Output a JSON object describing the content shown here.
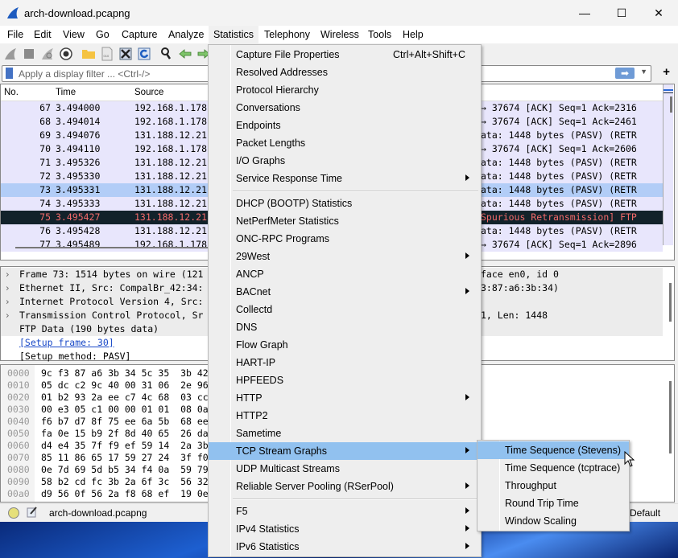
{
  "window": {
    "title": "arch-download.pcapng",
    "controls": {
      "minimize": "—",
      "maximize": "☐",
      "close": "✕"
    }
  },
  "menubar": [
    "File",
    "Edit",
    "View",
    "Go",
    "Capture",
    "Analyze",
    "Statistics",
    "Telephony",
    "Wireless",
    "Tools",
    "Help"
  ],
  "toolbar": {
    "icons": [
      "start-capture-icon",
      "stop-capture-icon",
      "restart-capture-icon",
      "capture-options-icon",
      "open-file-icon",
      "save-file-icon",
      "close-file-icon",
      "reload-file-icon",
      "find-packet-icon",
      "go-back-icon",
      "go-forward-icon"
    ]
  },
  "filter": {
    "placeholder": "Apply a display filter ... <Ctrl-/>",
    "apply_label": "➡",
    "add_label": "+"
  },
  "packet_list": {
    "columns": [
      "No.",
      "Time",
      "Source"
    ],
    "rows": [
      {
        "no": "67",
        "time": "3.494000",
        "source": "192.168.1.178",
        "info": "→ 37674 [ACK] Seq=1 Ack=2316"
      },
      {
        "no": "68",
        "time": "3.494014",
        "source": "192.168.1.178",
        "info": "→ 37674 [ACK] Seq=1 Ack=2461"
      },
      {
        "no": "69",
        "time": "3.494076",
        "source": "131.188.12.21",
        "info": "ata: 1448 bytes (PASV) (RETR"
      },
      {
        "no": "70",
        "time": "3.494110",
        "source": "192.168.1.178",
        "info": "→ 37674 [ACK] Seq=1 Ack=2606"
      },
      {
        "no": "71",
        "time": "3.495326",
        "source": "131.188.12.21",
        "info": "ata: 1448 bytes (PASV) (RETR"
      },
      {
        "no": "72",
        "time": "3.495330",
        "source": "131.188.12.21",
        "info": "ata: 1448 bytes (PASV) (RETR"
      },
      {
        "no": "73",
        "time": "3.495331",
        "source": "131.188.12.21",
        "info": "ata: 1448 bytes (PASV) (RETR"
      },
      {
        "no": "74",
        "time": "3.495333",
        "source": "131.188.12.21",
        "info": "ata: 1448 bytes (PASV) (RETR"
      },
      {
        "no": "75",
        "time": "3.495427",
        "source": "131.188.12.21",
        "info": "Spurious Retransmission] FTP"
      },
      {
        "no": "76",
        "time": "3.495428",
        "source": "131.188.12.21",
        "info": "ata: 1448 bytes (PASV) (RETR"
      },
      {
        "no": "77",
        "time": "3.495489",
        "source": "192.168.1.178",
        "info": "→ 37674 [ACK] Seq=1 Ack=2896"
      }
    ]
  },
  "packet_detail": {
    "rows": [
      {
        "expander": "›",
        "left": "Frame 73: 1514 bytes on wire (121",
        "right": "face en0, id 0"
      },
      {
        "expander": "›",
        "left": "Ethernet II, Src: CompalBr_42:34:",
        "right": "3:87:a6:3b:34)"
      },
      {
        "expander": "›",
        "left": "Internet Protocol Version 4, Src:",
        "right": ""
      },
      {
        "expander": "›",
        "left": "Transmission Control Protocol, Sr",
        "right": "1, Len: 1448"
      },
      {
        "expander": "",
        "left": "FTP Data (190 bytes data)",
        "right": ""
      },
      {
        "expander": "",
        "left": "[Setup frame: 30]",
        "right": ""
      },
      {
        "expander": "",
        "left": "[Setup method: PASV]",
        "right": ""
      }
    ]
  },
  "packet_bytes": {
    "rows": [
      {
        "offset": "0000",
        "hex": "9c f3 87 a6 3b 34 5c 35  3b 42"
      },
      {
        "offset": "0010",
        "hex": "05 dc c2 9c 40 00 31 06  2e 96"
      },
      {
        "offset": "0020",
        "hex": "01 b2 93 2a ee c7 4c 68  03 cc"
      },
      {
        "offset": "0030",
        "hex": "00 e3 05 c1 00 00 01 01  08 0a"
      },
      {
        "offset": "0040",
        "hex": "f6 b7 d7 8f 75 ee 6a 5b  68 ee"
      },
      {
        "offset": "0050",
        "hex": "fa 0e 15 b9 2f 8d 40 65  26 da"
      },
      {
        "offset": "0060",
        "hex": "d4 e4 35 7f f9 ef 59 14  2a 3b"
      },
      {
        "offset": "0070",
        "hex": "85 11 86 65 17 59 27 24  3f f0"
      },
      {
        "offset": "0080",
        "hex": "0e 7d 69 5d b5 34 f4 0a  59 79"
      },
      {
        "offset": "0090",
        "hex": "58 b2 cd fc 3b 2a 6f 3c  56 32"
      },
      {
        "offset": "00a0",
        "hex": "d9 56 0f 56 2a f8 68 ef  19 0e"
      }
    ]
  },
  "statusbar": {
    "file": "arch-download.pcapng",
    "profile": "Default"
  },
  "statistics_menu": {
    "items": [
      {
        "label": "Capture File Properties",
        "shortcut": "Ctrl+Alt+Shift+C",
        "submenu": false
      },
      {
        "label": "Resolved Addresses",
        "shortcut": "",
        "submenu": false
      },
      {
        "label": "Protocol Hierarchy",
        "shortcut": "",
        "submenu": false
      },
      {
        "label": "Conversations",
        "shortcut": "",
        "submenu": false
      },
      {
        "label": "Endpoints",
        "shortcut": "",
        "submenu": false
      },
      {
        "label": "Packet Lengths",
        "shortcut": "",
        "submenu": false
      },
      {
        "label": "I/O Graphs",
        "shortcut": "",
        "submenu": false
      },
      {
        "label": "Service Response Time",
        "shortcut": "",
        "submenu": true
      },
      {
        "label": "DHCP (BOOTP) Statistics",
        "shortcut": "",
        "submenu": false
      },
      {
        "label": "NetPerfMeter Statistics",
        "shortcut": "",
        "submenu": false
      },
      {
        "label": "ONC-RPC Programs",
        "shortcut": "",
        "submenu": false
      },
      {
        "label": "29West",
        "shortcut": "",
        "submenu": true
      },
      {
        "label": "ANCP",
        "shortcut": "",
        "submenu": false
      },
      {
        "label": "BACnet",
        "shortcut": "",
        "submenu": true
      },
      {
        "label": "Collectd",
        "shortcut": "",
        "submenu": false
      },
      {
        "label": "DNS",
        "shortcut": "",
        "submenu": false
      },
      {
        "label": "Flow Graph",
        "shortcut": "",
        "submenu": false
      },
      {
        "label": "HART-IP",
        "shortcut": "",
        "submenu": false
      },
      {
        "label": "HPFEEDS",
        "shortcut": "",
        "submenu": false
      },
      {
        "label": "HTTP",
        "shortcut": "",
        "submenu": true
      },
      {
        "label": "HTTP2",
        "shortcut": "",
        "submenu": false
      },
      {
        "label": "Sametime",
        "shortcut": "",
        "submenu": false
      },
      {
        "label": "TCP Stream Graphs",
        "shortcut": "",
        "submenu": true,
        "highlighted": true
      },
      {
        "label": "UDP Multicast Streams",
        "shortcut": "",
        "submenu": false
      },
      {
        "label": "Reliable Server Pooling (RSerPool)",
        "shortcut": "",
        "submenu": true
      },
      {
        "label": "F5",
        "shortcut": "",
        "submenu": true
      },
      {
        "label": "IPv4 Statistics",
        "shortcut": "",
        "submenu": true
      },
      {
        "label": "IPv6 Statistics",
        "shortcut": "",
        "submenu": true
      }
    ]
  },
  "tcp_stream_graphs_submenu": {
    "items": [
      {
        "label": "Time Sequence (Stevens)",
        "highlighted": true
      },
      {
        "label": "Time Sequence (tcptrace)"
      },
      {
        "label": "Throughput"
      },
      {
        "label": "Round Trip Time"
      },
      {
        "label": "Window Scaling"
      }
    ]
  },
  "colors": {
    "menu_highlight": "#91c1ef",
    "row_normal": "#e8e6fc",
    "row_selected": "#b2cdf7",
    "row_bad_bg": "#12222a",
    "row_bad_fg": "#f46b6b"
  }
}
